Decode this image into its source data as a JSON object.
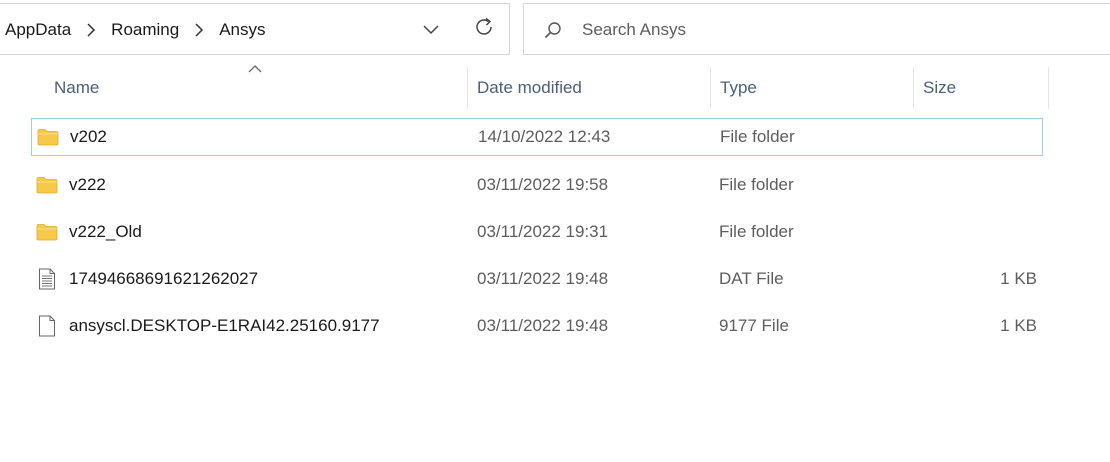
{
  "address_bar": {
    "breadcrumbs": [
      "AppData",
      "Roaming",
      "Ansys"
    ]
  },
  "search": {
    "placeholder": "Search Ansys"
  },
  "columns": {
    "name": "Name",
    "date": "Date modified",
    "type": "Type",
    "size": "Size"
  },
  "files": [
    {
      "name": "v202",
      "date": "14/10/2022 12:43",
      "type": "File folder",
      "size": "",
      "icon": "folder-icon",
      "selected": true
    },
    {
      "name": "v222",
      "date": "03/11/2022 19:58",
      "type": "File folder",
      "size": "",
      "icon": "folder-icon",
      "selected": false
    },
    {
      "name": "v222_Old",
      "date": "03/11/2022 19:31",
      "type": "File folder",
      "size": "",
      "icon": "folder-icon",
      "selected": false
    },
    {
      "name": "17494668691621262027",
      "date": "03/11/2022 19:48",
      "type": "DAT File",
      "size": "1 KB",
      "icon": "text-file-icon",
      "selected": false
    },
    {
      "name": "ansyscl.DESKTOP-E1RAI42.25160.9177",
      "date": "03/11/2022 19:48",
      "type": "9177 File",
      "size": "1 KB",
      "icon": "blank-file-icon",
      "selected": false
    }
  ],
  "colors": {
    "folder": "#f7c948",
    "selection_border": "#99d1db",
    "header_text": "#4c607a"
  }
}
